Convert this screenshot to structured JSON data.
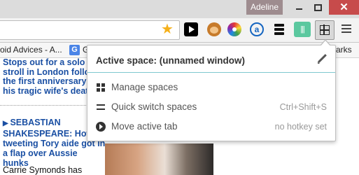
{
  "window": {
    "user_name": "Adeline",
    "close_glyph": "✕"
  },
  "toolbar": {
    "extensions": [
      "play-icon",
      "monkey-icon",
      "color-wheel-icon",
      "a-icon",
      "layers-icon",
      "waveform-icon",
      "spaces-icon",
      "menu-icon"
    ],
    "star_color": "#f5b01a"
  },
  "bookmarks": {
    "item1": "oid Advices - A...",
    "item2_icon": "G",
    "item2": "G",
    "right": "arks"
  },
  "page": {
    "story1": {
      "lines": [
        "Stops out for a solo",
        "stroll in London follow",
        "the first anniversary c",
        "his tragic wife's death"
      ]
    },
    "story2": {
      "title_lines": [
        "SEBASTIAN",
        "SHAKESPEARE: How",
        "tweeting Tory aide got in",
        "a flap over Aussie",
        "hunks"
      ],
      "text": "Carrie Symonds has"
    }
  },
  "popup": {
    "title": "Active space: (unnamed window)",
    "accent": "#7ec8d0",
    "items": [
      {
        "label": "Manage spaces",
        "shortcut": ""
      },
      {
        "label": "Quick switch spaces",
        "shortcut": "Ctrl+Shift+S"
      },
      {
        "label": "Move active tab",
        "shortcut": "no hotkey set"
      }
    ]
  }
}
